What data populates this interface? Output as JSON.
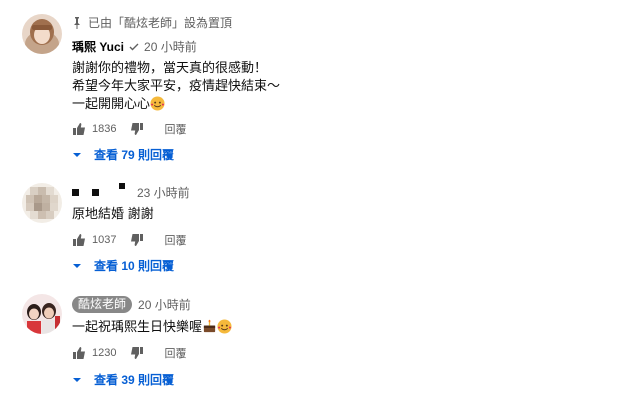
{
  "pinned": {
    "text": "已由「酷炫老師」設為置頂"
  },
  "comments": [
    {
      "author": "瑀熙 Yuci",
      "verified": true,
      "time": "20 小時前",
      "lines": [
        "謝謝你的禮物，當天真的很感動！",
        "希望今年大家平安，疫情趕快結束～",
        "一起開開心心"
      ],
      "emoji": "smiling-face-hearts",
      "likes": "1836",
      "reply_label": "回覆",
      "view_replies": "查看 79 則回覆"
    },
    {
      "author": "",
      "time": "23 小時前",
      "lines": [
        "原地結婚 謝謝"
      ],
      "likes": "1037",
      "reply_label": "回覆",
      "view_replies": "查看 10 則回覆"
    },
    {
      "author": "酷炫老師",
      "is_channel_owner": true,
      "time": "20 小時前",
      "lines": [
        "一起祝瑀熙生日快樂喔"
      ],
      "emoji": [
        "cake",
        "smiling-face-hearts"
      ],
      "likes": "1230",
      "reply_label": "回覆",
      "view_replies": "查看 39 則回覆"
    }
  ],
  "colors": {
    "link": "#065fd4",
    "muted": "#606060",
    "badge": "#888888"
  }
}
